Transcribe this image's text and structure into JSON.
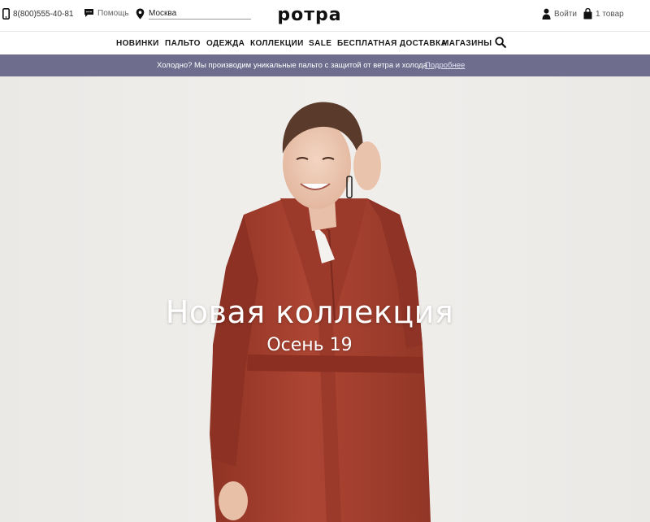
{
  "header": {
    "phone": "8(800)555-40-81",
    "help_label": "Помощь",
    "city_value": "Москва",
    "logo_text": "ротра",
    "login_label": "Войти",
    "cart_label": "1 товар",
    "icons": [
      "phone-icon",
      "chat-bubble-icon",
      "location-pin-icon",
      "user-icon",
      "shopping-bag-icon",
      "search-icon"
    ]
  },
  "nav": {
    "items": [
      "НОВИНКИ",
      "ПАЛЬТО",
      "ОДЕЖДА",
      "КОЛЛЕКЦИИ",
      "SALE",
      "БЕСПЛАТНАЯ ДОСТАВКА",
      "МАГАЗИНЫ"
    ]
  },
  "promo": {
    "text": "Холодно? Мы производим уникальные пальто с защитой от ветра и холода",
    "link": "Подробнее",
    "background_color": "#6e6d8d"
  },
  "hero": {
    "title": "Новая коллекция",
    "subtitle": "Осень 19",
    "coat_color": "#a8412f"
  }
}
